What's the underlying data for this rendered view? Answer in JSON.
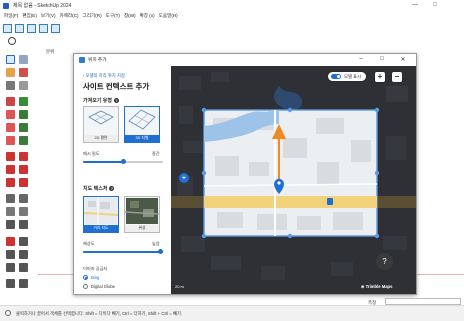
{
  "window": {
    "title": "제목 없음 - SketchUp 2024",
    "minimize": "—",
    "maximize": "□"
  },
  "menu": [
    "파일(F)",
    "편집(E)",
    "보기(V)",
    "카메라(C)",
    "그리기(R)",
    "도구(T)",
    "창(W)",
    "확장 (x)",
    "도움말(H)"
  ],
  "viewport": {
    "scene_tab": "분위"
  },
  "dialog": {
    "title": "위치 추가",
    "minimize": "–",
    "maximize": "□",
    "close": "✕",
    "panel": {
      "back_link": "‹ 모델의 지리 위치 지정",
      "heading": "사이트 컨텍스트 추가",
      "imagery_type_label": "가져오기 유형",
      "cards": [
        {
          "label": "2D 평면",
          "selected": false
        },
        {
          "label": "3D 지형",
          "selected": true
        }
      ],
      "detail_label": "메시 밀도",
      "detail_value": "중간",
      "detail_level": 0.5,
      "map_texture_label": "지도 텍스처",
      "texture_cards": [
        {
          "label": "거리 지도",
          "selected": true
        },
        {
          "label": "위성",
          "selected": false
        }
      ],
      "resolution_label": "해상도",
      "resolution_value": "높음",
      "resolution_level": 1.0,
      "provider_label": "이미지 공급자",
      "providers": [
        {
          "label": "Bing",
          "selected": true
        },
        {
          "label": "Digital Globe",
          "selected": false
        }
      ]
    },
    "map": {
      "toggle_label": "모델 표시",
      "zoom_in": "+",
      "zoom_out": "−",
      "add_handle": "+",
      "help": "?",
      "scale": "20 m",
      "brand": "⊕ Trimble Maps"
    }
  },
  "status": {
    "message": "클릭하거나 끌어서 객체를 선택합니다. Shift = 다이다 빼기, Ctrl = 더하기, Shift + Ctrl = 빼기.",
    "measure_label": "측정"
  },
  "colors": {
    "accent": "#1f6fd1",
    "arrow": "#f08a24",
    "road": "#d9b35a",
    "river": "#5b8fc9"
  }
}
